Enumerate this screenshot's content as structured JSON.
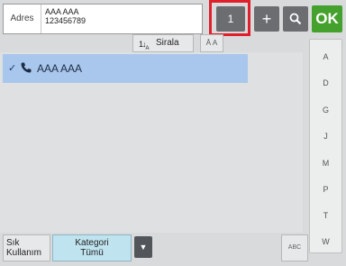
{
  "address": {
    "label": "Adres",
    "line1": "AAA AAA",
    "line2": "123456789"
  },
  "toolbar": {
    "count": "1",
    "ok_label": "OK"
  },
  "sort": {
    "label": "Sirala",
    "toggle_label": "Ā A"
  },
  "list": {
    "rows": [
      {
        "name": "AAA AAA"
      }
    ]
  },
  "index": {
    "letters": [
      "A",
      "D",
      "G",
      "J",
      "M",
      "P",
      "T",
      "W"
    ]
  },
  "bottom": {
    "frequent_line1": "Sık",
    "frequent_line2": "Kullanım",
    "category_line1": "Kategori",
    "category_line2": "Tümü",
    "abc_label": "ABC"
  },
  "colors": {
    "ok_green": "#45a12d",
    "highlight_red": "#e01f2d",
    "selected_row": "#a9c7ec",
    "category_active": "#bfe3ef"
  }
}
